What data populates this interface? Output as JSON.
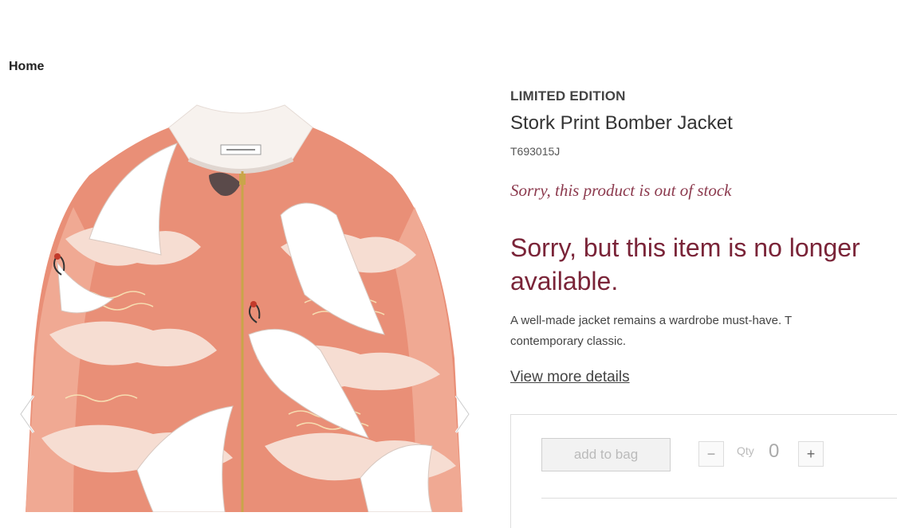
{
  "breadcrumb": {
    "home_label": "Home"
  },
  "gallery": {
    "prev_icon": "chevron-left-icon",
    "next_icon": "chevron-right-icon",
    "image_subject": "stork-print-bomber-jacket"
  },
  "product": {
    "brand": "LIMITED EDITION",
    "name": "Stork Print Bomber Jacket",
    "sku": "T693015J",
    "stock_note": "Sorry, this product is out of stock",
    "unavailable_message": "Sorry, but this item is no longer available.",
    "description_line1": "A well-made jacket remains a wardrobe must-have. T",
    "description_line2": "contemporary classic.",
    "view_more_label": "View more details"
  },
  "cart": {
    "add_to_bag_label": "add to bag",
    "qty_label": "Qty",
    "qty_value": "0",
    "minus_label": "−",
    "plus_label": "+"
  },
  "colors": {
    "accent": "#7a2438",
    "stock_note": "#8c3a4e",
    "jacket_coral": "#e98f77",
    "jacket_cream": "#f6ddd2"
  }
}
